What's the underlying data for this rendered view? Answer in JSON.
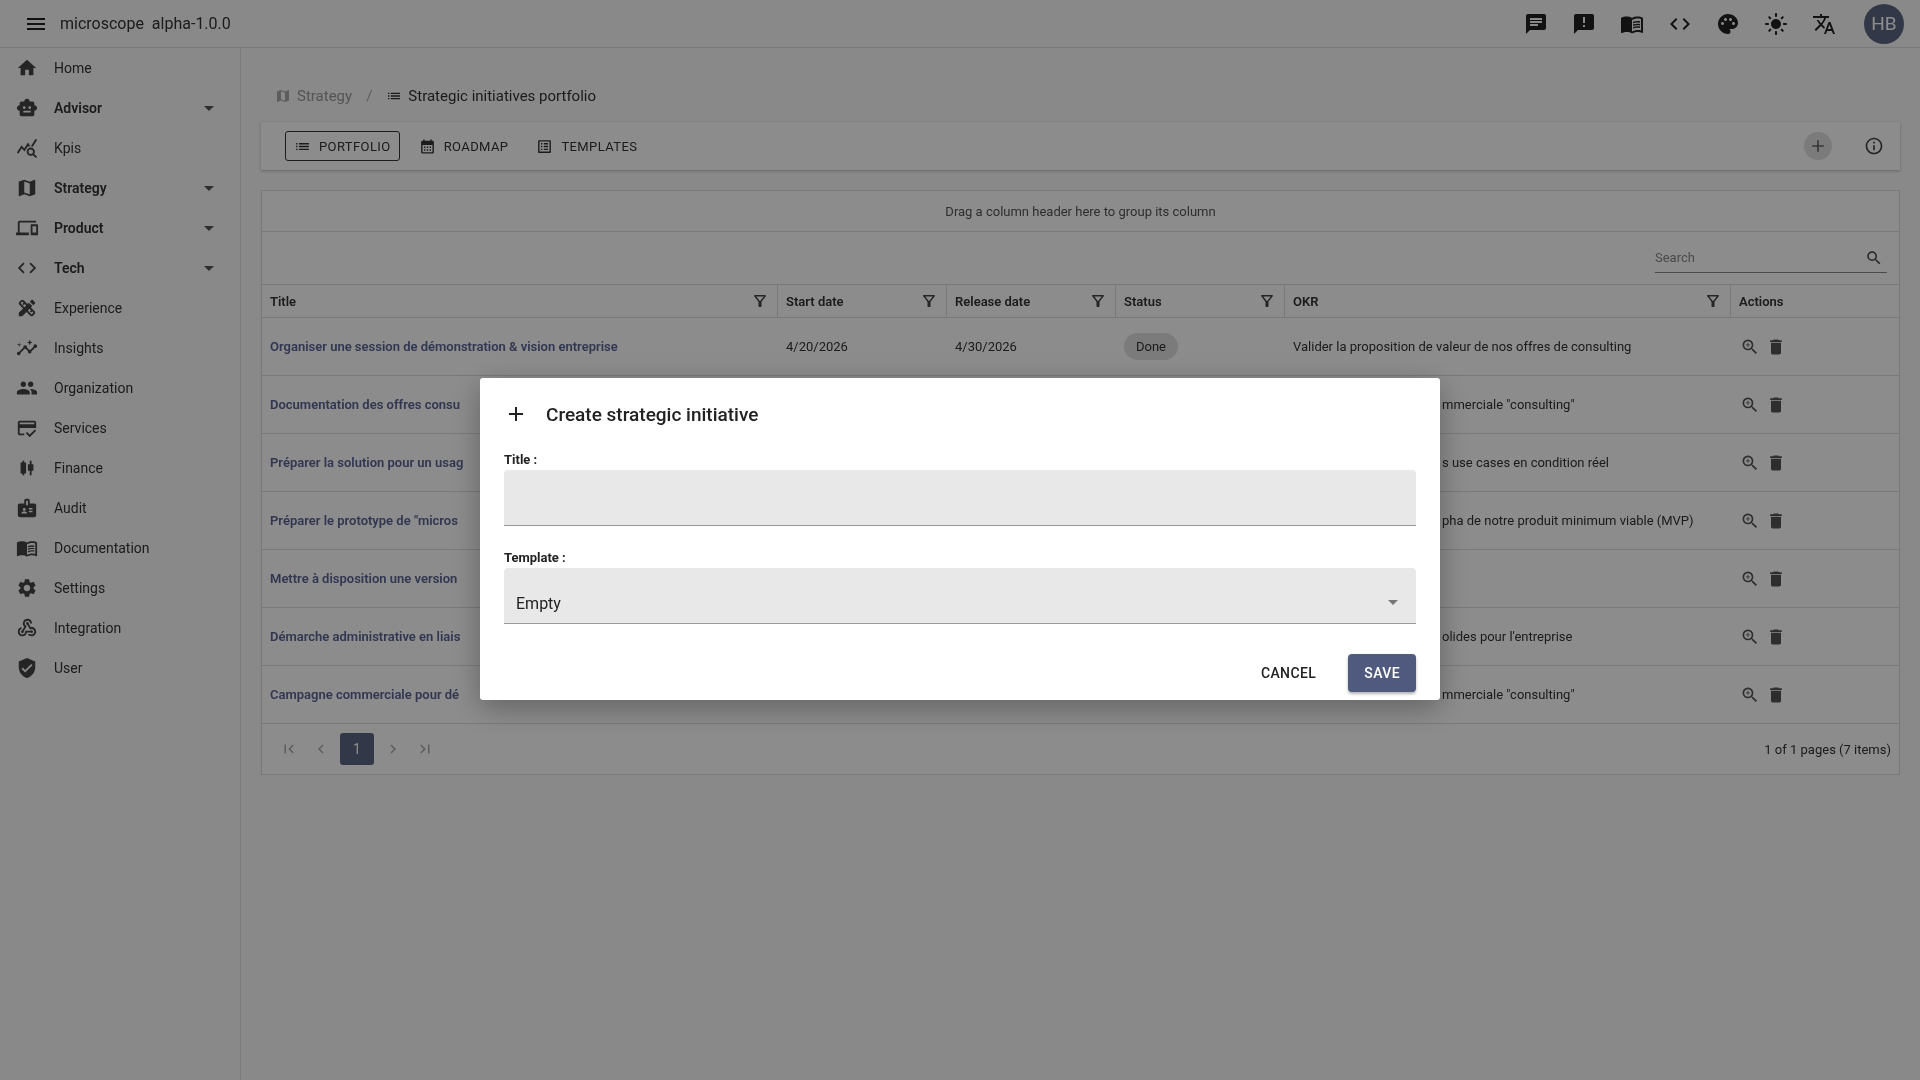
{
  "app_bar": {
    "title": "microscope",
    "version": "alpha-1.0.0",
    "avatar": "HB"
  },
  "sidebar": {
    "items": [
      {
        "label": "Home",
        "expandable": false
      },
      {
        "label": "Advisor",
        "expandable": true
      },
      {
        "label": "Kpis",
        "expandable": false
      },
      {
        "label": "Strategy",
        "expandable": true
      },
      {
        "label": "Product",
        "expandable": true
      },
      {
        "label": "Tech",
        "expandable": true
      },
      {
        "label": "Experience",
        "expandable": false
      },
      {
        "label": "Insights",
        "expandable": false
      },
      {
        "label": "Organization",
        "expandable": false
      },
      {
        "label": "Services",
        "expandable": false
      },
      {
        "label": "Finance",
        "expandable": false
      },
      {
        "label": "Audit",
        "expandable": false
      },
      {
        "label": "Documentation",
        "expandable": false
      },
      {
        "label": "Settings",
        "expandable": false
      },
      {
        "label": "Integration",
        "expandable": false
      },
      {
        "label": "User",
        "expandable": false
      }
    ]
  },
  "breadcrumb": {
    "separator": "/",
    "items": [
      {
        "label": "Strategy",
        "current": false
      },
      {
        "label": "Strategic initiatives portfolio",
        "current": true
      }
    ]
  },
  "tabs": [
    {
      "label": "PORTFOLIO",
      "selected": true
    },
    {
      "label": "ROADMAP",
      "selected": false
    },
    {
      "label": "TEMPLATES",
      "selected": false
    }
  ],
  "table": {
    "group_hint": "Drag a column header here to group its column",
    "search": {
      "placeholder": "Search"
    },
    "columns": [
      "Title",
      "Start date",
      "Release date",
      "Status",
      "OKR",
      "Actions"
    ],
    "rows": [
      {
        "title": "Organiser une session de démonstration & vision entreprise",
        "start_date": "4/20/2026",
        "release_date": "4/30/2026",
        "status": "Done",
        "okr": "Valider la proposition de valeur de nos offres de consulting"
      },
      {
        "title": "Documentation des offres consu",
        "okr": "mmerciale \"consulting\""
      },
      {
        "title": "Préparer la solution pour un usag",
        "okr": "s use cases en condition réel"
      },
      {
        "title": "Préparer le prototype de \"micros",
        "okr": "pha de notre produit minimum viable (MVP)"
      },
      {
        "title": "Mettre à disposition une version"
      },
      {
        "title": "Démarche administrative en liais",
        "okr": "olides pour l'entreprise"
      },
      {
        "title": "Campagne commerciale pour dé",
        "okr": "mmerciale \"consulting\""
      }
    ],
    "pagination": {
      "pages": [
        {
          "label": "1",
          "selected": true
        }
      ],
      "summary": "1 of 1 pages (7 items)"
    }
  },
  "dialog": {
    "title": "Create strategic initiative",
    "fields": [
      {
        "label": "Title :",
        "kind": "text"
      },
      {
        "label": "Template :",
        "kind": "select",
        "value": "Empty"
      }
    ],
    "buttons": [
      {
        "label": "CANCEL",
        "primary": false
      },
      {
        "label": "SAVE",
        "primary": true
      }
    ]
  }
}
